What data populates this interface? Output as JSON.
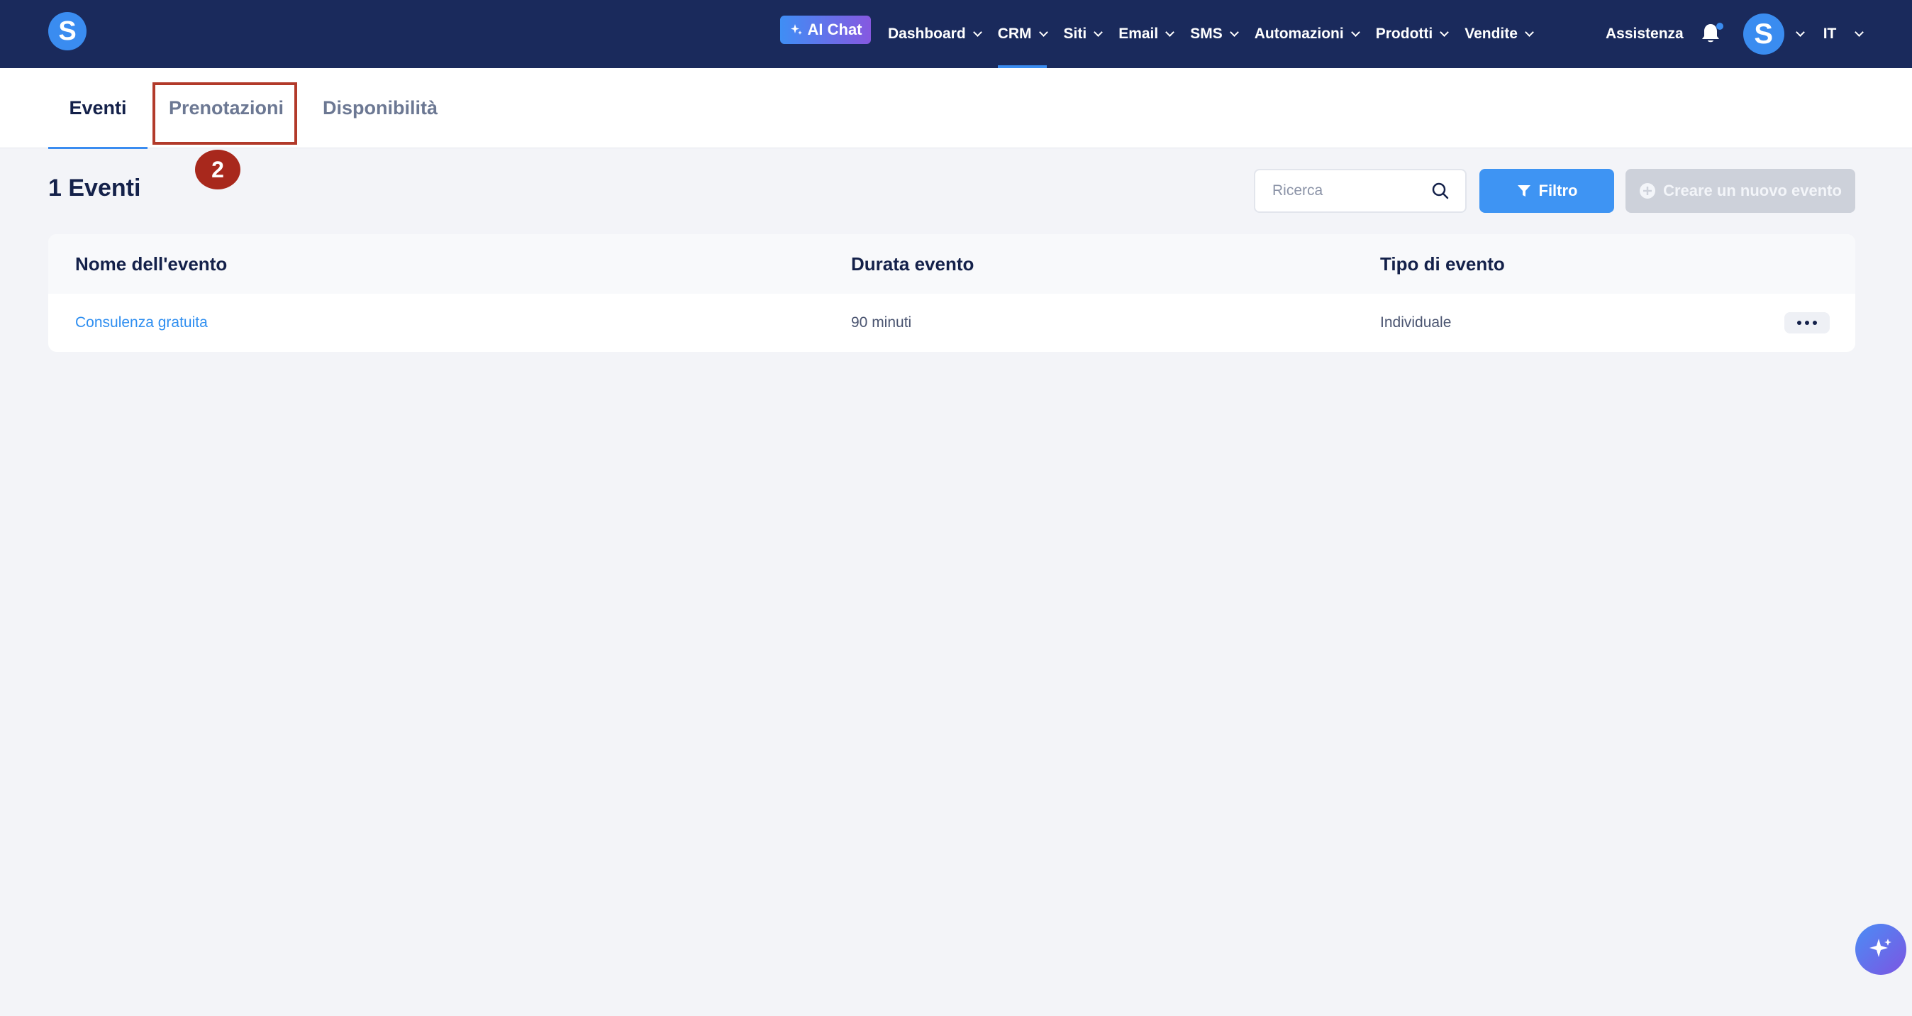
{
  "topbar": {
    "logo_letter": "S",
    "ai_chat_label": "AI Chat",
    "nav": [
      {
        "label": "Dashboard",
        "active": false
      },
      {
        "label": "CRM",
        "active": true
      },
      {
        "label": "Siti",
        "active": false
      },
      {
        "label": "Email",
        "active": false
      },
      {
        "label": "SMS",
        "active": false
      },
      {
        "label": "Automazioni",
        "active": false
      },
      {
        "label": "Prodotti",
        "active": false
      },
      {
        "label": "Vendite",
        "active": false
      }
    ],
    "help_label": "Assistenza",
    "avatar_letter": "S",
    "language": "IT"
  },
  "tabs": [
    {
      "label": "Eventi",
      "active": true
    },
    {
      "label": "Prenotazioni",
      "active": false
    },
    {
      "label": "Disponibilità",
      "active": false
    }
  ],
  "annotation": {
    "step": "2"
  },
  "main": {
    "title": "1 Eventi",
    "search_placeholder": "Ricerca",
    "filter_label": "Filtro",
    "new_event_label": "Creare un nuovo evento"
  },
  "table": {
    "columns": [
      "Nome dell'evento",
      "Durata evento",
      "Tipo di evento"
    ],
    "rows": [
      {
        "name": "Consulenza gratuita",
        "duration": "90 minuti",
        "type": "Individuale"
      }
    ]
  },
  "colors": {
    "topbar": "#1a2a5c",
    "accent": "#3a8cf0",
    "highlight": "#b23a2a"
  }
}
